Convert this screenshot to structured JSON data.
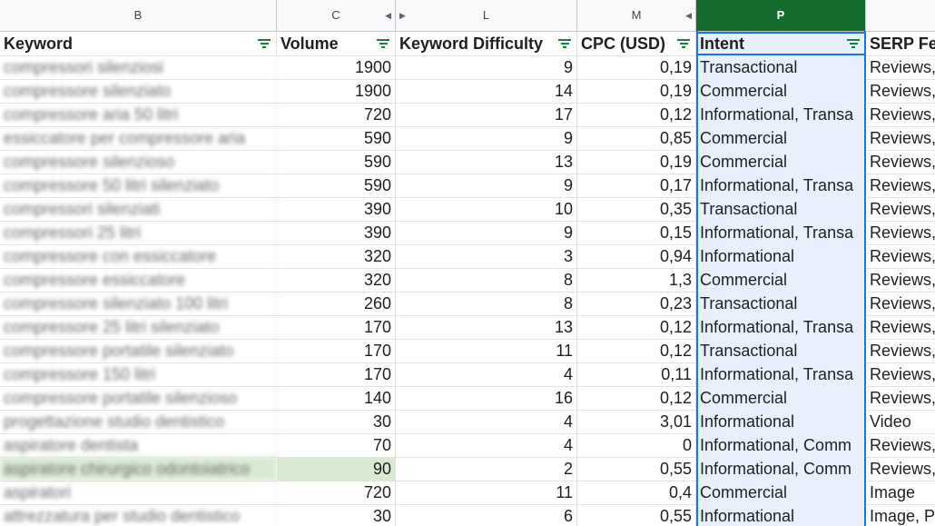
{
  "column_letters": [
    "B",
    "C",
    "L",
    "M",
    "P",
    ""
  ],
  "headers": {
    "keyword": "Keyword",
    "volume": "Volume",
    "difficulty": "Keyword Difficulty",
    "cpc": "CPC (USD)",
    "intent": "Intent",
    "serp": "SERP Fea"
  },
  "colors": {
    "selected_column": "#146c2e",
    "selection_border": "#1a73e8",
    "filter_icon": "#188038",
    "highlight_row": "#d9ead3"
  },
  "rows": [
    {
      "kw": "compressori silenziosi",
      "vol": "1900",
      "kd": "9",
      "cpc": "0,19",
      "intent": "Transactional",
      "serp": "Reviews,"
    },
    {
      "kw": "compressore silenziato",
      "vol": "1900",
      "kd": "14",
      "cpc": "0,19",
      "intent": "Commercial",
      "serp": "Reviews,"
    },
    {
      "kw": "compressore aria 50 litri",
      "vol": "720",
      "kd": "17",
      "cpc": "0,12",
      "intent": "Informational, Transa",
      "serp": "Reviews,"
    },
    {
      "kw": "essiccatore per compressore aria",
      "vol": "590",
      "kd": "9",
      "cpc": "0,85",
      "intent": "Commercial",
      "serp": "Reviews,"
    },
    {
      "kw": "compressore silenzioso",
      "vol": "590",
      "kd": "13",
      "cpc": "0,19",
      "intent": "Commercial",
      "serp": "Reviews,"
    },
    {
      "kw": "compressore 50 litri silenziato",
      "vol": "590",
      "kd": "9",
      "cpc": "0,17",
      "intent": "Informational, Transa",
      "serp": "Reviews,"
    },
    {
      "kw": "compressori silenziati",
      "vol": "390",
      "kd": "10",
      "cpc": "0,35",
      "intent": "Transactional",
      "serp": "Reviews,"
    },
    {
      "kw": "compressori 25 litri",
      "vol": "390",
      "kd": "9",
      "cpc": "0,15",
      "intent": "Informational, Transa",
      "serp": "Reviews,"
    },
    {
      "kw": "compressore con essiccatore",
      "vol": "320",
      "kd": "3",
      "cpc": "0,94",
      "intent": "Informational",
      "serp": "Reviews,"
    },
    {
      "kw": "compressore essiccatore",
      "vol": "320",
      "kd": "8",
      "cpc": "1,3",
      "intent": "Commercial",
      "serp": "Reviews,"
    },
    {
      "kw": "compressore silenziato 100 litri",
      "vol": "260",
      "kd": "8",
      "cpc": "0,23",
      "intent": "Transactional",
      "serp": "Reviews,"
    },
    {
      "kw": "compressore 25 litri silenziato",
      "vol": "170",
      "kd": "13",
      "cpc": "0,12",
      "intent": "Informational, Transa",
      "serp": "Reviews,"
    },
    {
      "kw": "compressore portatile silenziato",
      "vol": "170",
      "kd": "11",
      "cpc": "0,12",
      "intent": "Transactional",
      "serp": "Reviews,"
    },
    {
      "kw": "compressore 150 litri",
      "vol": "170",
      "kd": "4",
      "cpc": "0,11",
      "intent": "Informational, Transa",
      "serp": "Reviews,"
    },
    {
      "kw": "compressore portatile silenzioso",
      "vol": "140",
      "kd": "16",
      "cpc": "0,12",
      "intent": "Commercial",
      "serp": "Reviews,"
    },
    {
      "kw": "progettazione studio dentistico",
      "vol": "30",
      "kd": "4",
      "cpc": "3,01",
      "intent": "Informational",
      "serp": "Video"
    },
    {
      "kw": "aspiratore dentista",
      "vol": "70",
      "kd": "4",
      "cpc": "0",
      "intent": "Informational, Comm",
      "serp": "Reviews,"
    },
    {
      "kw": "aspiratore chirurgico odontoiatrico",
      "vol": "90",
      "kd": "2",
      "cpc": "0,55",
      "intent": "Informational, Comm",
      "serp": "Reviews,",
      "highlight": true
    },
    {
      "kw": "aspiratori",
      "vol": "720",
      "kd": "11",
      "cpc": "0,4",
      "intent": "Commercial",
      "serp": "Image"
    },
    {
      "kw": "attrezzatura per studio dentistico",
      "vol": "30",
      "kd": "6",
      "cpc": "0,55",
      "intent": "Informational",
      "serp": "Image, P"
    }
  ]
}
